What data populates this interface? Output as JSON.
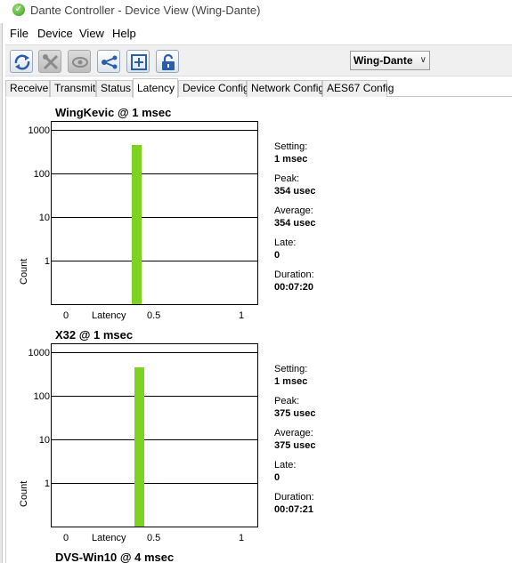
{
  "window": {
    "title": "Dante Controller - Device View (Wing-Dante)"
  },
  "menu": [
    "File",
    "Device",
    "View",
    "Help"
  ],
  "toolbar": {
    "buttons": [
      {
        "icon": "refresh-icon",
        "enabled": true
      },
      {
        "icon": "tools-icon",
        "enabled": false
      },
      {
        "icon": "eye-icon",
        "enabled": false
      },
      {
        "icon": "network-share-icon",
        "enabled": true
      },
      {
        "icon": "add-window-icon",
        "enabled": true
      },
      {
        "icon": "padlock-icon",
        "enabled": true
      }
    ],
    "device_select": "Wing-Dante"
  },
  "tabs": [
    {
      "label": "Receive",
      "active": false
    },
    {
      "label": "Transmit",
      "active": false
    },
    {
      "label": "Status",
      "active": false
    },
    {
      "label": "Latency",
      "active": true
    },
    {
      "label": "Device Config",
      "active": false
    },
    {
      "label": "Network Config",
      "active": false
    },
    {
      "label": "AES67 Config",
      "active": false
    }
  ],
  "stat_labels": {
    "setting": "Setting:",
    "peak": "Peak:",
    "average": "Average:",
    "late": "Late:",
    "duration": "Duration:"
  },
  "colors": {
    "bar": "#7ed321",
    "active_tab": "#ffffff"
  },
  "chart_data": [
    {
      "type": "bar",
      "title": "WingKevic @ 1 msec",
      "xlabel": "Latency",
      "ylabel": "Count",
      "yscale": "log",
      "y_ticks": [
        "1000",
        "100",
        "10",
        "1"
      ],
      "x_ticks": [
        "0",
        "0.5",
        "1"
      ],
      "xlim": [
        0,
        1
      ],
      "ylim": [
        0.1,
        2000
      ],
      "bars": [
        {
          "x": 0.354,
          "value": 450
        }
      ],
      "stats": {
        "setting": "1 msec",
        "peak": "354 usec",
        "average": "354 usec",
        "late": "0",
        "duration": "00:07:20"
      }
    },
    {
      "type": "bar",
      "title": "X32 @ 1 msec",
      "xlabel": "Latency",
      "ylabel": "Count",
      "yscale": "log",
      "y_ticks": [
        "1000",
        "100",
        "10",
        "1"
      ],
      "x_ticks": [
        "0",
        "0.5",
        "1"
      ],
      "xlim": [
        0,
        1
      ],
      "ylim": [
        0.1,
        2000
      ],
      "bars": [
        {
          "x": 0.375,
          "value": 450
        }
      ],
      "stats": {
        "setting": "1 msec",
        "peak": "375 usec",
        "average": "375 usec",
        "late": "0",
        "duration": "00:07:21"
      }
    },
    {
      "type": "bar",
      "title": "DVS-Win10 @ 4 msec"
    }
  ]
}
